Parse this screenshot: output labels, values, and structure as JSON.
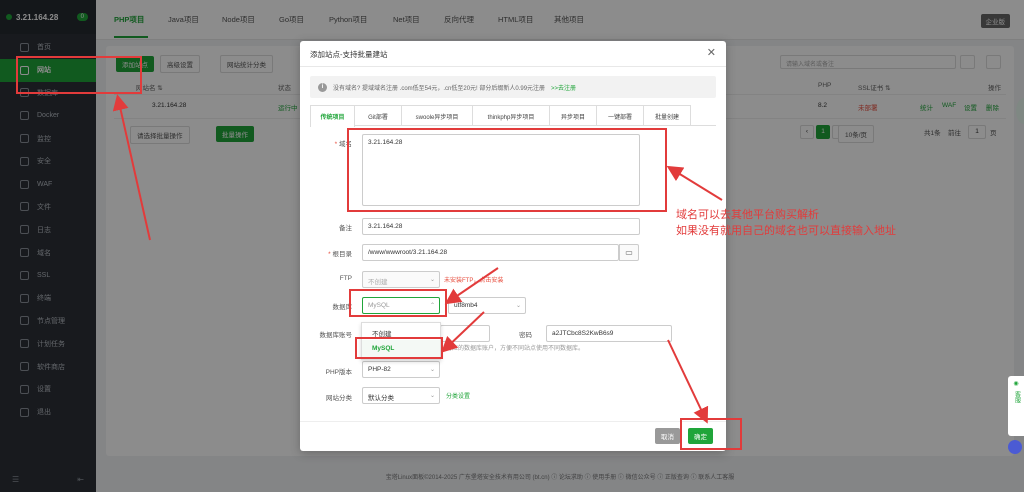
{
  "sidebar": {
    "server_ip": "3.21.164.28",
    "badge": "0",
    "items": [
      {
        "label": "首页",
        "icon": "home-icon"
      },
      {
        "label": "网站",
        "icon": "website-icon"
      },
      {
        "label": "数据库",
        "icon": "database-icon"
      },
      {
        "label": "Docker",
        "icon": "docker-icon"
      },
      {
        "label": "监控",
        "icon": "monitor-icon"
      },
      {
        "label": "安全",
        "icon": "shield-icon"
      },
      {
        "label": "WAF",
        "icon": "firewall-icon"
      },
      {
        "label": "文件",
        "icon": "folder-icon"
      },
      {
        "label": "日志",
        "icon": "log-icon"
      },
      {
        "label": "域名",
        "icon": "globe-icon"
      },
      {
        "label": "SSL",
        "icon": "ssl-icon"
      },
      {
        "label": "终端",
        "icon": "terminal-icon"
      },
      {
        "label": "节点管理",
        "icon": "node-icon"
      },
      {
        "label": "计划任务",
        "icon": "clock-icon"
      },
      {
        "label": "软件商店",
        "icon": "store-icon"
      },
      {
        "label": "设置",
        "icon": "gear-icon"
      },
      {
        "label": "退出",
        "icon": "logout-icon"
      }
    ]
  },
  "top_tabs": [
    "PHP项目",
    "Java项目",
    "Node项目",
    "Go项目",
    "Python项目",
    "Net项目",
    "反向代理",
    "HTML项目",
    "其他项目"
  ],
  "enterprise": "企业版",
  "background": {
    "add_site": "添加站点",
    "advanced": "高级设置",
    "stats": "网站统计分类",
    "search_placeholder": "请输入域名或备注",
    "headers": {
      "name": "网站名 ⇅",
      "status": "状态",
      "php": "PHP",
      "ssl": "SSL证书 ⇅",
      "ops": "操作"
    },
    "row": {
      "name": "3.21.164.28",
      "status": "运行中",
      "php": "8.2",
      "ssl": "未部署",
      "stats": "统计",
      "waf": "WAF",
      "settings": "设置",
      "delete": "删除"
    },
    "batch_select": "请选择批量操作",
    "batch_btn": "批量操作",
    "page": "1",
    "per_page": "10条/页",
    "total": "共1条",
    "goto": "前往",
    "goto_page": "1",
    "goto_suffix": "页"
  },
  "footer": "宝塔Linux面板©2014-2025 广东堡塔安全技术有用公司 (bt.cn)  ⓘ 论坛求助  ⓘ 使用手册  ⓘ 微信公众号  ⓘ 正版查询  ⓘ 联系人工客服",
  "float_help": "客服",
  "modal": {
    "title": "添加站点-支持批量建站",
    "notice": "没有域名? 提域域名注册 .com低至54元，.cn低至20元! 部分后缀新人0.99元注册",
    "notice_link": ">>去注册",
    "tabs": [
      "传统项目",
      "Git部署",
      "swoole异步项目",
      "thinkphp异步项目",
      "异步项目",
      "一键部署",
      "批量创建"
    ],
    "domain_label": "域名",
    "domain_value": "3.21.164.28",
    "remark_label": "备注",
    "remark_value": "3.21.164.28",
    "root_label": "根目录",
    "root_value": "/www/wwwroot/3.21.164.28",
    "ftp_label": "FTP",
    "ftp_value": "不创建",
    "ftp_note": "未安装FTP，点击安装",
    "db_label": "数据库",
    "db_value": "MySQL",
    "charset_value": "utf8mb4",
    "dropdown_options": [
      "不创建",
      "MySQL"
    ],
    "db_account_label": "数据库账号",
    "db_password_label": "密码",
    "db_password_value": "a2JTCbc8S2KwB6s9",
    "db_note": "对应的数据库账户，方便不同站点使用不同数据库。",
    "php_label": "PHP版本",
    "php_value": "PHP-82",
    "category_label": "网站分类",
    "category_value": "默认分类",
    "category_link": "分类设置",
    "cancel": "取消",
    "ok": "确定"
  },
  "annotation": {
    "line1": "域名可以去其他平台购买解析",
    "line2": "如果没有就用自己的域名也可以直接输入地址",
    "color": "#e23b3b"
  }
}
